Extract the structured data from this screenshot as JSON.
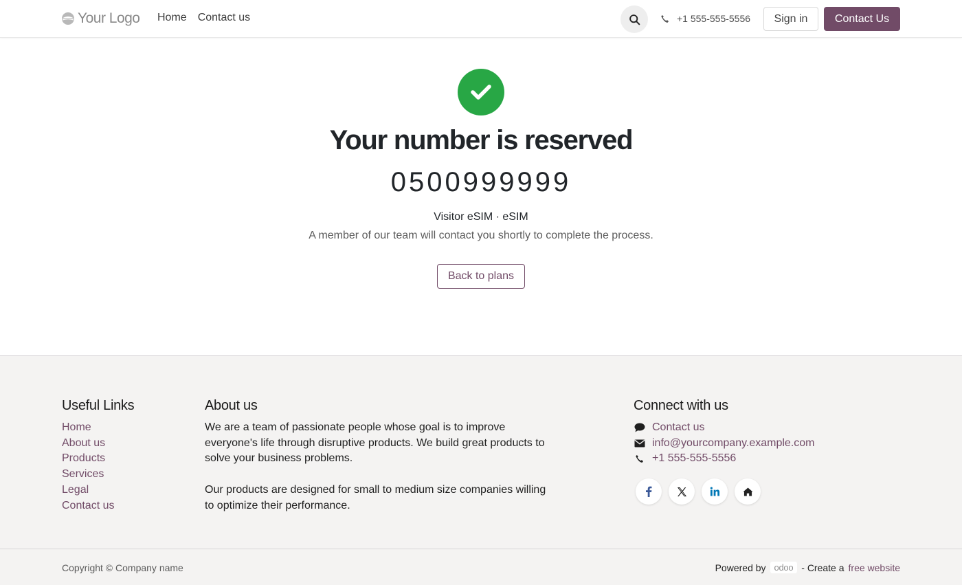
{
  "header": {
    "logo_text": "Your Logo",
    "nav": [
      {
        "label": "Home"
      },
      {
        "label": "Contact us"
      }
    ],
    "phone": "+1 555-555-5556",
    "signin_label": "Sign in",
    "contact_label": "Contact Us"
  },
  "main": {
    "title": "Your number is reserved",
    "number": "0500999999",
    "plan": "Visitor eSIM · eSIM",
    "description": "A member of our team will contact you shortly to complete the process.",
    "back_label": "Back to plans"
  },
  "footer": {
    "useful_links_title": "Useful Links",
    "useful_links": [
      {
        "label": "Home"
      },
      {
        "label": "About us"
      },
      {
        "label": "Products"
      },
      {
        "label": "Services"
      },
      {
        "label": "Legal"
      },
      {
        "label": "Contact us"
      }
    ],
    "about_title": "About us",
    "about_p1": "We are a team of passionate people whose goal is to improve everyone's life through disruptive products. We build great products to solve your business problems.",
    "about_p2": "Our products are designed for small to medium size companies willing to optimize their performance.",
    "connect_title": "Connect with us",
    "connect": {
      "contact": "Contact us",
      "email": "info@yourcompany.example.com",
      "phone": "+1 555-555-5556"
    },
    "socials": [
      {
        "icon": "facebook-icon"
      },
      {
        "icon": "x-icon"
      },
      {
        "icon": "linkedin-icon"
      },
      {
        "icon": "home-icon"
      }
    ]
  },
  "bottom": {
    "copyright": "Copyright © Company name",
    "powered_by": "Powered by",
    "odoo_logo": "odoo",
    "create_prefix": "- Create a",
    "create_link": "free website"
  },
  "colors": {
    "brand": "#714b67",
    "success": "#28a745",
    "footer_bg": "#f4f3f2"
  }
}
